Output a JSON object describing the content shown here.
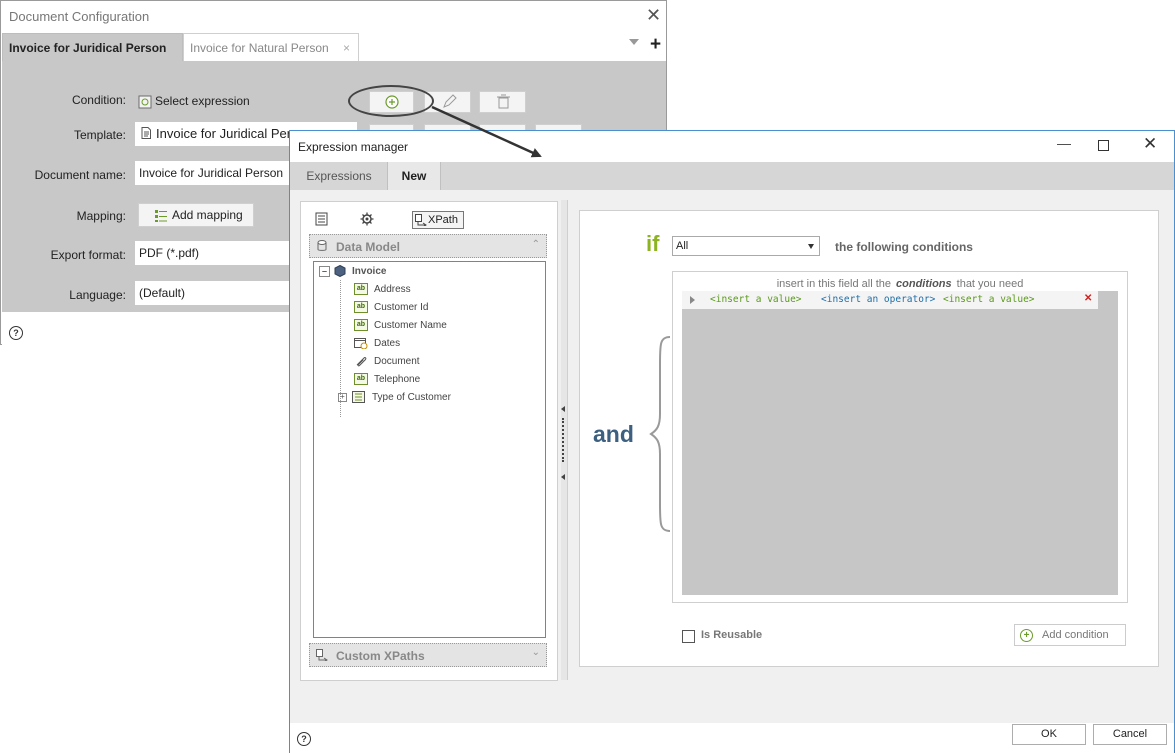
{
  "doc_config": {
    "title": "Document Configuration",
    "close_glyph": "✕",
    "tabs": [
      {
        "label": "Invoice for Juridical Person"
      },
      {
        "label": "Invoice for Natural Person",
        "close": "×"
      }
    ],
    "add_tab_glyph": "+",
    "fields": {
      "condition": {
        "label": "Condition:",
        "value": "Select expression"
      },
      "template": {
        "label": "Template:",
        "value": "Invoice for Juridical Per"
      },
      "document_name": {
        "label": "Document name:",
        "value": "Invoice for Juridical Person"
      },
      "mapping": {
        "label": "Mapping:",
        "button": "Add mapping"
      },
      "export_format": {
        "label": "Export format:",
        "value": "PDF (*.pdf)"
      },
      "language": {
        "label": "Language:",
        "value": "(Default)"
      }
    },
    "help_glyph": "?"
  },
  "expression_manager": {
    "title": "Expression manager",
    "tabs": {
      "expressions": "Expressions",
      "new": "New"
    },
    "toolbar": {
      "xpath": "XPath"
    },
    "data_model_header": "Data Model",
    "tree": {
      "root": "Invoice",
      "items": [
        {
          "label": "Address",
          "icon": "text-field-icon"
        },
        {
          "label": "Customer Id",
          "icon": "text-field-icon"
        },
        {
          "label": "Customer Name",
          "icon": "text-field-icon"
        },
        {
          "label": "Dates",
          "icon": "calendar-icon"
        },
        {
          "label": "Document",
          "icon": "paperclip-icon"
        },
        {
          "label": "Telephone",
          "icon": "text-field-icon"
        },
        {
          "label": "Type of Customer",
          "icon": "list-icon"
        }
      ],
      "ab_text": "ab"
    },
    "custom_xpaths_header": "Custom XPaths",
    "if_word": "if",
    "quantifier_select": "All",
    "following_text": "the following conditions",
    "and_word": "and",
    "conditions_hint": {
      "before": "insert in this field all the",
      "bold": "conditions",
      "after": "that you need"
    },
    "condition_row": {
      "value1": "<insert a value>",
      "operator": "<insert an operator>",
      "value2": "<insert a value>",
      "remove_glyph": "✕"
    },
    "is_reusable_label": "Is Reusable",
    "add_condition_label": "Add condition",
    "add_condition_glyph": "+",
    "ok_label": "OK",
    "cancel_label": "Cancel",
    "help_glyph": "?"
  },
  "colors": {
    "if_green": "#8cb320",
    "and_blue": "#3d6080",
    "value_placeholder": "#5a9a1a",
    "operator_placeholder": "#1f6fa8",
    "remove_red": "#d21f1f"
  }
}
